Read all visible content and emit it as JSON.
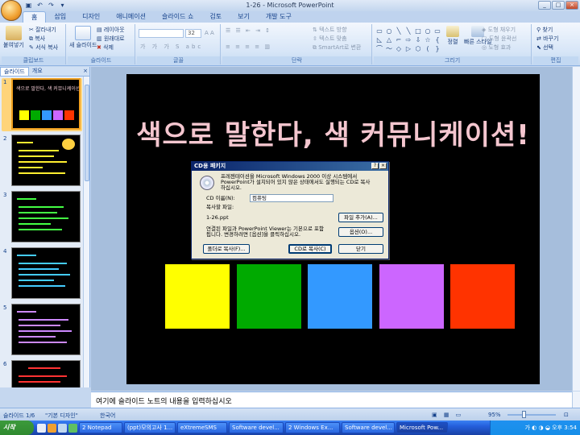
{
  "window": {
    "title": "1-26 - Microsoft PowerPoint"
  },
  "tabs": [
    "홈",
    "삽입",
    "디자인",
    "애니메이션",
    "슬라이드 쇼",
    "검토",
    "보기",
    "개발 도구"
  ],
  "ribbon": {
    "clipboard": {
      "label": "클립보드",
      "paste": "붙여넣기",
      "cut": "잘라내기",
      "copy": "복사",
      "format_painter": "서식 복사"
    },
    "slides": {
      "label": "슬라이드",
      "new_slide": "새 슬라이드",
      "layout": "레이아웃",
      "reset": "원래대로",
      "delete": "삭제"
    },
    "font": {
      "label": "글꼴",
      "font_size": "32"
    },
    "paragraph": {
      "label": "단락",
      "text_direction": "텍스트 방향",
      "align_text": "텍스트 맞춤",
      "smartart": "SmartArt로 변환"
    },
    "drawing": {
      "label": "그리기",
      "arrange": "정렬",
      "quick_styles": "빠른 스타일",
      "shape_fill": "도형 채우기",
      "shape_outline": "도형 윤곽선",
      "shape_effects": "도형 효과"
    },
    "editing": {
      "label": "편집",
      "find": "찾기",
      "replace": "바꾸기",
      "select": "선택"
    }
  },
  "panel": {
    "tab_slides": "슬라이드",
    "tab_outline": "개요",
    "thumb_numbers": [
      "1",
      "2",
      "3",
      "4",
      "5",
      "6"
    ],
    "thumb1_title": "색으로 말한다, 색 커뮤니케이션!"
  },
  "slide": {
    "title": "색으로 말한다, 색 커뮤니케이션!",
    "squares": [
      "#ffff00",
      "#00aa00",
      "#3399ff",
      "#cc66ff",
      "#ff3300"
    ]
  },
  "dialog": {
    "title": "CD용 패키지",
    "description_line1": "프레젠테이션을 Microsoft Windows 2000 이상 시스템에서",
    "description_line2": "PowerPoint가 설치되어 있지 않은 상태에서도 실행되는 CD로 복사",
    "description_line3": "하십시오.",
    "cd_name_label": "CD 이름(N):",
    "cd_name_value": "컴퓨팅",
    "files_label": "복사할 파일:",
    "file_name": "1-26.ppt",
    "add_files_button": "파일 추가(A)...",
    "note_line1": "연결된 파일과 PowerPoint Viewer는 기본으로 포함",
    "note_line2": "됩니다. 변경하려면 [옵션]을 클릭하십시오.",
    "options_button": "옵션(O)...",
    "copy_folder_button": "폴더로 복사(F)...",
    "copy_cd_button": "CD로 복사(C)",
    "close_button": "닫기"
  },
  "notes": {
    "placeholder": "여기에 슬라이드 노트의 내용을 입력하십시오"
  },
  "statusbar": {
    "slide_info": "슬라이드 1/6",
    "theme": "\"기본 디자인\"",
    "language": "한국어",
    "zoom": "95%"
  },
  "taskbar": {
    "start": "시작",
    "items": [
      "2 Notepad",
      "(ppt)모의고사 1...",
      "eXtremeSMS",
      "Software devel...",
      "2 Windows Ex...",
      "Software devel...",
      "Microsoft Pow..."
    ],
    "tray_ime": "가",
    "clock": "오후 3:54"
  }
}
